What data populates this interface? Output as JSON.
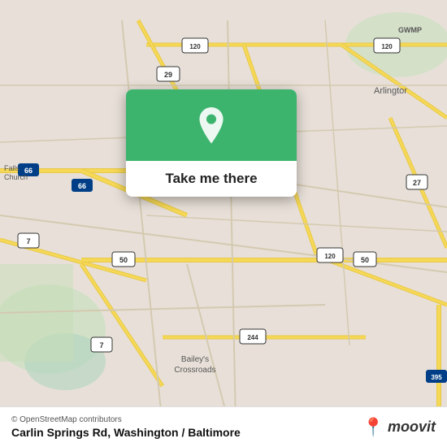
{
  "map": {
    "background_color": "#e8e0d8"
  },
  "popup": {
    "take_me_there": "Take me there",
    "pin_color": "#3cb46e"
  },
  "bottom_bar": {
    "osm_credit": "© OpenStreetMap contributors",
    "location": "Carlin Springs Rd, Washington / Baltimore",
    "moovit_text": "moovit"
  }
}
